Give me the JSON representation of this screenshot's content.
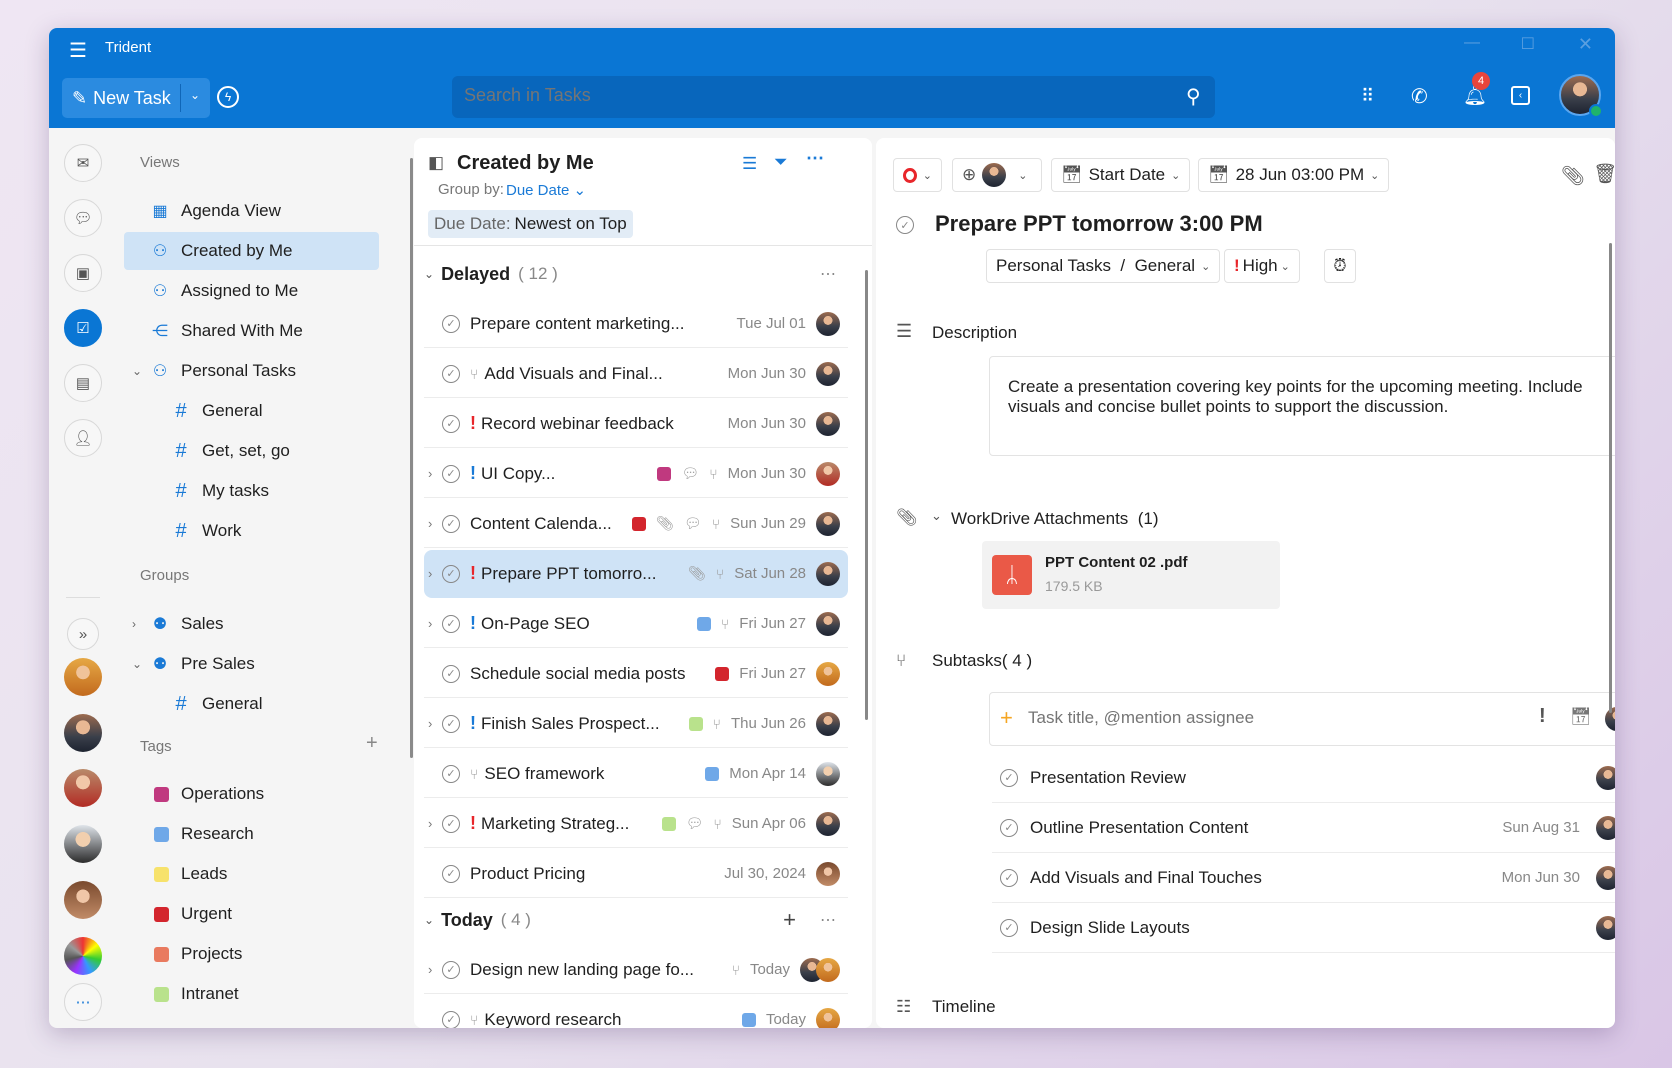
{
  "app": {
    "title": "Trident"
  },
  "toolbar": {
    "new_task": "New Task",
    "search_placeholder": "Search in Tasks",
    "notification_count": "4"
  },
  "nav": {
    "views_label": "Views",
    "views": [
      {
        "label": "Agenda View",
        "icon": "calendar-icon"
      },
      {
        "label": "Created by Me",
        "icon": "person-arrow-icon",
        "selected": true
      },
      {
        "label": "Assigned to Me",
        "icon": "person-arrow-icon"
      },
      {
        "label": "Shared With Me",
        "icon": "share-icon"
      },
      {
        "label": "Personal Tasks",
        "icon": "person-icon"
      }
    ],
    "personal_subs": [
      "General",
      "Get, set, go",
      "My tasks",
      "Work"
    ],
    "groups_label": "Groups",
    "groups": [
      {
        "label": "Sales"
      },
      {
        "label": "Pre Sales"
      }
    ],
    "presales_subs": [
      "General"
    ],
    "tags_label": "Tags",
    "tags": [
      {
        "label": "Operations",
        "color": "#c0397f"
      },
      {
        "label": "Research",
        "color": "#6fa8e8"
      },
      {
        "label": "Leads",
        "color": "#f7e26b"
      },
      {
        "label": "Urgent",
        "color": "#d3252d"
      },
      {
        "label": "Projects",
        "color": "#e97a5f"
      },
      {
        "label": "Intranet",
        "color": "#b9e28c"
      }
    ]
  },
  "list": {
    "title": "Created by Me",
    "group_by_label": "Group by:",
    "group_by_value": "Due Date",
    "sort_label": "Due Date:",
    "sort_value": "Newest on Top",
    "groups": [
      {
        "name": "Delayed",
        "count": "( 12 )",
        "tasks": [
          {
            "title": "Prepare content marketing...",
            "date": "Tue Jul 01"
          },
          {
            "title": "Add Visuals and Final...",
            "date": "Mon Jun 30",
            "is_subtask": true
          },
          {
            "title": "Record webinar feedback",
            "date": "Mon Jun 30",
            "priority": "red"
          },
          {
            "title": "UI Copy...",
            "date": "Mon Jun 30",
            "priority": "blue",
            "expand": true,
            "tags": [
              "#c0397f"
            ],
            "comment": true,
            "subtasks": true,
            "avatar": "r"
          },
          {
            "title": "Content Calenda...",
            "date": "Sun Jun 29",
            "expand": true,
            "tags": [
              "#d3252d"
            ],
            "attach": true,
            "comment": true,
            "subtasks": true
          },
          {
            "title": "Prepare PPT tomorro...",
            "date": "Sat Jun 28",
            "priority": "red",
            "expand": true,
            "attach": true,
            "subtasks": true,
            "selected": true
          },
          {
            "title": "On-Page SEO",
            "date": "Fri Jun 27",
            "priority": "blue",
            "expand": true,
            "tags": [
              "#6fa8e8"
            ],
            "subtasks": true
          },
          {
            "title": "Schedule social media posts",
            "date": "Fri Jun 27",
            "tags": [
              "#d3252d"
            ],
            "avatar": "w"
          },
          {
            "title": "Finish Sales Prospect...",
            "date": "Thu Jun 26",
            "priority": "blue",
            "expand": true,
            "tags": [
              "#b9e28c"
            ],
            "subtasks": true
          },
          {
            "title": "SEO framework",
            "date": "Mon Apr 14",
            "is_subtask": true,
            "tags": [
              "#6fa8e8"
            ],
            "avatar": "g"
          },
          {
            "title": "Marketing Strateg...",
            "date": "Sun Apr 06",
            "priority": "red",
            "expand": true,
            "tags": [
              "#b9e28c"
            ],
            "comment": true,
            "subtasks": true
          },
          {
            "title": "Product Pricing",
            "date": "Jul 30, 2024",
            "avatar": "f"
          }
        ]
      },
      {
        "name": "Today",
        "count": "( 4 )",
        "tasks": [
          {
            "title": "Design new landing page fo...",
            "date": "Today",
            "expand": true,
            "subtasks": true,
            "avatar": "two"
          },
          {
            "title": "Keyword research",
            "date": "Today",
            "is_subtask": true,
            "tags": [
              "#6fa8e8"
            ],
            "avatar": "w"
          }
        ]
      }
    ]
  },
  "detail": {
    "start_date": "Start Date",
    "due_date": "28 Jun 03:00 PM",
    "title": "Prepare PPT tomorrow 3:00 PM",
    "project": "Personal Tasks  /  General",
    "priority": "High",
    "description_label": "Description",
    "description": "Create a presentation covering key points for the upcoming meeting. Include visuals and concise bullet points to support the discussion.",
    "attachments_label": "WorkDrive Attachments  (1)",
    "attachment": {
      "name": "PPT Content 02 .pdf",
      "size": "179.5 KB"
    },
    "subtasks_label": "Subtasks( 4 )",
    "subtask_placeholder": "Task title, @mention assignee",
    "subtasks": [
      {
        "title": "Presentation Review",
        "date": ""
      },
      {
        "title": "Outline Presentation Content",
        "date": "Sun Aug 31"
      },
      {
        "title": "Add Visuals and Final Touches",
        "date": "Mon Jun 30"
      },
      {
        "title": "Design Slide Layouts",
        "date": ""
      }
    ],
    "timeline_label": "Timeline"
  },
  "colors": {
    "brand": "#0a76d4",
    "priority_high": "#e8262b",
    "priority_med": "#1a7ad6"
  }
}
